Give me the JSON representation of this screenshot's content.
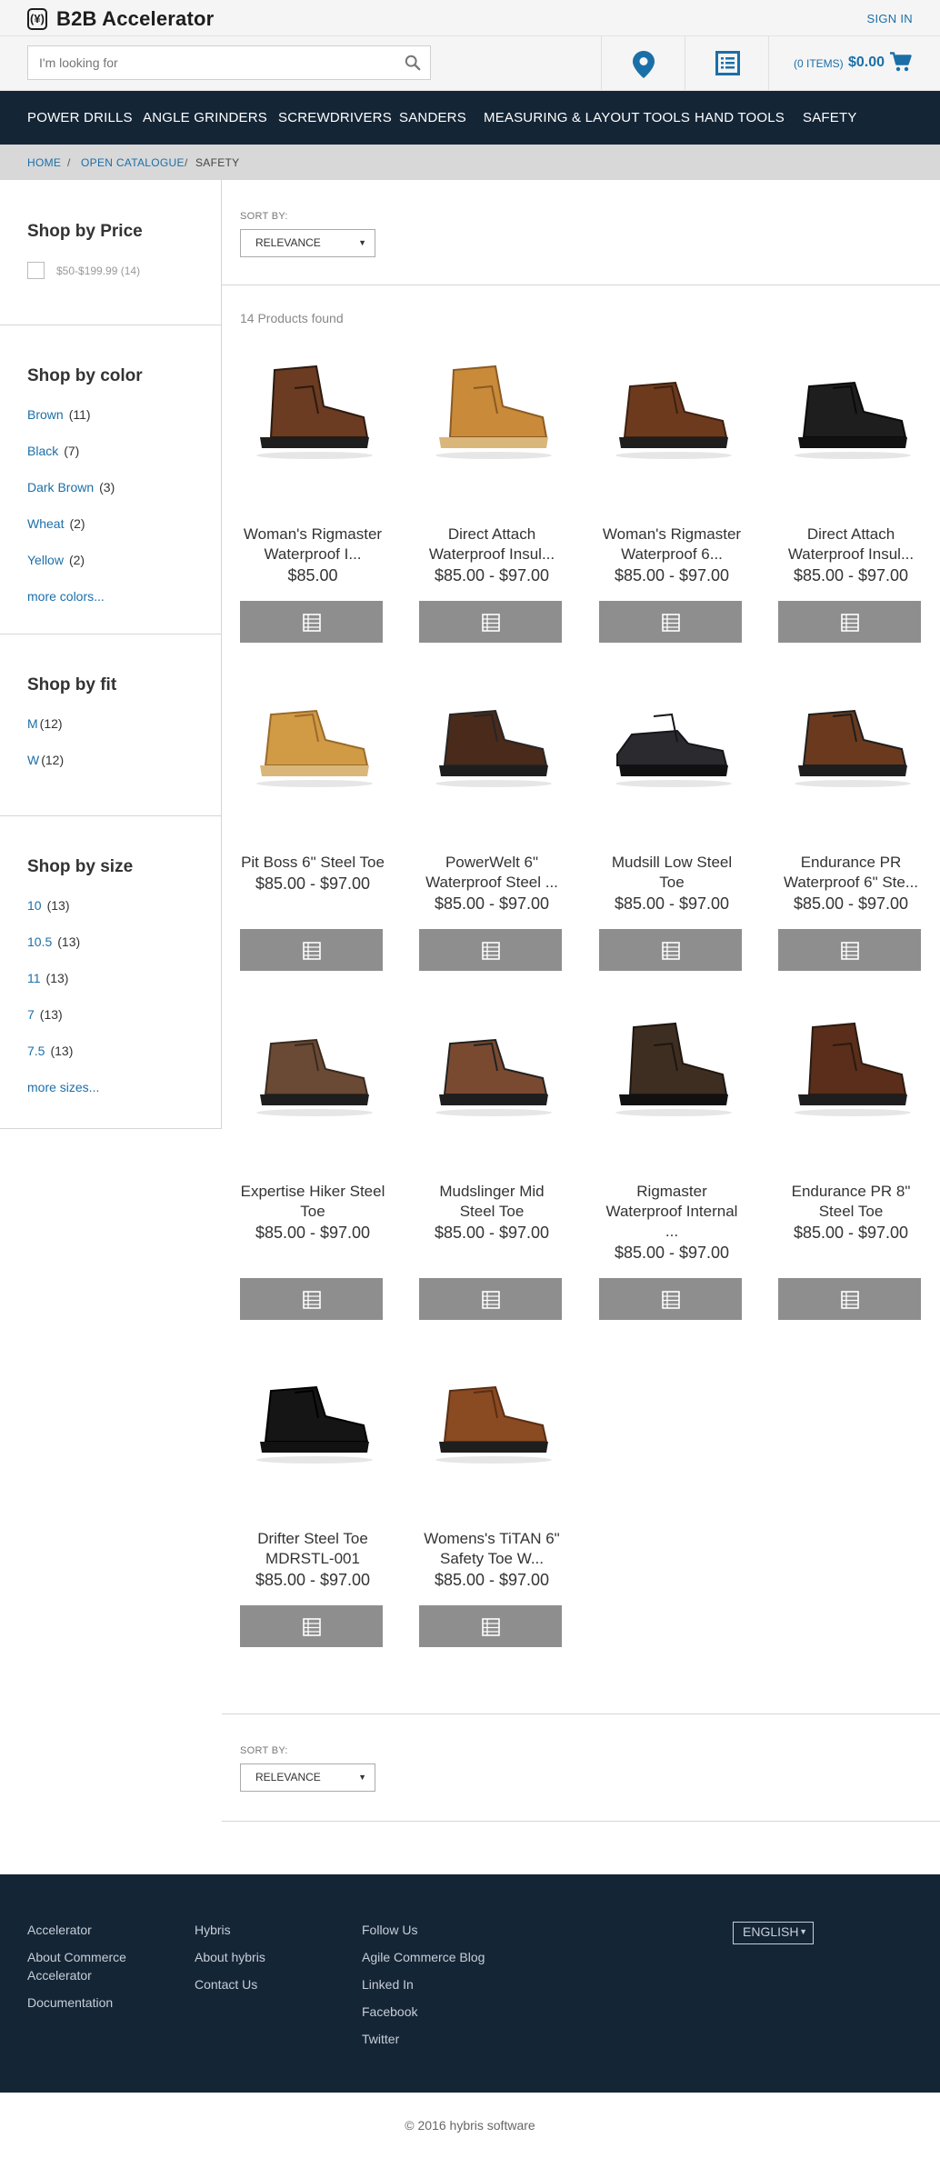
{
  "header": {
    "brand": "B2B Accelerator",
    "brand_mark": "(¥)",
    "sign_in": "SIGN IN",
    "search_placeholder": "I'm looking for",
    "cart_items": "(0 ITEMS)",
    "cart_total": "$0.00",
    "icons": [
      "search-icon",
      "location-pin-icon",
      "quick-order-icon",
      "cart-icon"
    ],
    "accent_color": "#1b6fa8"
  },
  "nav": {
    "background": "#142536",
    "items": [
      "POWER DRILLS",
      "ANGLE GRINDERS",
      "SCREWDRIVERS",
      "SANDERS",
      "MEASURING & LAYOUT TOOLS",
      "HAND TOOLS",
      "SAFETY"
    ]
  },
  "breadcrumb": {
    "home": "HOME",
    "catalogue": "OPEN CATALOGUE",
    "current": "SAFETY",
    "sep": "/"
  },
  "facets": {
    "price": {
      "title": "Shop by Price",
      "options": [
        {
          "label": "$50-$199.99",
          "count": "(14)"
        }
      ]
    },
    "color": {
      "title": "Shop by color",
      "options": [
        {
          "label": "Brown",
          "count": "(11)"
        },
        {
          "label": "Black",
          "count": "(7)"
        },
        {
          "label": "Dark Brown",
          "count": "(3)"
        },
        {
          "label": "Wheat",
          "count": "(2)"
        },
        {
          "label": "Yellow",
          "count": "(2)"
        }
      ],
      "more": "more colors..."
    },
    "fit": {
      "title": "Shop by fit",
      "options": [
        {
          "label": "M",
          "count": "(12)"
        },
        {
          "label": "W",
          "count": "(12)"
        }
      ]
    },
    "size": {
      "title": "Shop by size",
      "options": [
        {
          "label": "10",
          "count": "(13)"
        },
        {
          "label": "10.5",
          "count": "(13)"
        },
        {
          "label": "11",
          "count": "(13)"
        },
        {
          "label": "7",
          "count": "(13)"
        },
        {
          "label": "7.5",
          "count": "(13)"
        }
      ],
      "more": "more sizes..."
    }
  },
  "sort": {
    "label": "SORT BY:",
    "selected": "RELEVANCE"
  },
  "results": {
    "found": "14 Products found"
  },
  "products": [
    {
      "name_1": "Woman's Rigmaster",
      "name_2": "Waterproof I...",
      "price": "$85.00"
    },
    {
      "name_1": "Direct Attach",
      "name_2": "Waterproof Insul...",
      "price": "$85.00 - $97.00"
    },
    {
      "name_1": "Woman's Rigmaster",
      "name_2": "Waterproof 6...",
      "price": "$85.00 - $97.00"
    },
    {
      "name_1": "Direct Attach",
      "name_2": "Waterproof Insul...",
      "price": "$85.00 - $97.00"
    },
    {
      "name_1": "Pit Boss 6\" Steel Toe",
      "name_2": "",
      "price": "$85.00 - $97.00"
    },
    {
      "name_1": "PowerWelt 6\"",
      "name_2": "Waterproof Steel ...",
      "price": "$85.00 - $97.00"
    },
    {
      "name_1": "Mudsill Low Steel",
      "name_2": "Toe",
      "price": "$85.00 - $97.00"
    },
    {
      "name_1": "Endurance PR",
      "name_2": "Waterproof 6\" Ste...",
      "price": "$85.00 - $97.00"
    },
    {
      "name_1": "Expertise Hiker Steel",
      "name_2": "Toe",
      "price": "$85.00 - $97.00"
    },
    {
      "name_1": "Mudslinger Mid",
      "name_2": "Steel Toe",
      "price": "$85.00 - $97.00"
    },
    {
      "name_1": "Rigmaster",
      "name_2": "Waterproof Internal",
      "name_3": "...",
      "price": "$85.00 - $97.00"
    },
    {
      "name_1": "Endurance PR 8\"",
      "name_2": "Steel Toe",
      "price": "$85.00 - $97.00"
    },
    {
      "name_1": "Drifter Steel Toe",
      "name_2": "MDRSTL-001",
      "price": "$85.00 - $97.00"
    },
    {
      "name_1": "Womens's TiTAN 6\"",
      "name_2": "Safety Toe W...",
      "price": "$85.00 - $97.00"
    }
  ],
  "footer": {
    "col1": [
      "Accelerator",
      "About Commerce",
      "Accelerator",
      "Documentation"
    ],
    "col2": [
      "Hybris",
      "About hybris",
      "Contact Us"
    ],
    "col3": [
      "Follow Us",
      "Agile Commerce Blog",
      "Linked In",
      "Facebook",
      "Twitter"
    ],
    "language": "ENGLISH",
    "copyright": "© 2016 hybris software"
  }
}
